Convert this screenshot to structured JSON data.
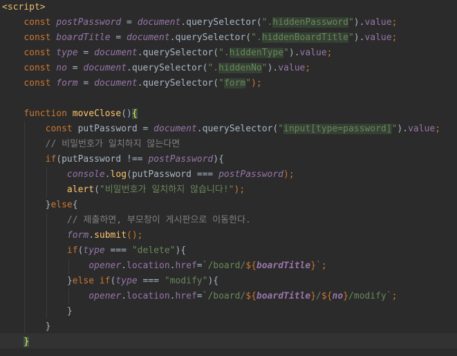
{
  "editor": {
    "language": "javascript",
    "colors": {
      "background": "#2b2b2b",
      "keyword": "#cc7832",
      "text": "#a9b7c6",
      "variable": "#9876aa",
      "function": "#ffc66d",
      "string": "#6a8759",
      "comment": "#808080",
      "tag": "#e8bf6a"
    }
  },
  "lines": [
    [
      {
        "t": "<script>",
        "c": "tag"
      }
    ],
    [
      {
        "t": "    "
      },
      {
        "t": "const ",
        "c": "kw"
      },
      {
        "t": "postPassword",
        "c": "var"
      },
      {
        "t": " = ",
        "c": "txt"
      },
      {
        "t": "document",
        "c": "obj"
      },
      {
        "t": ".querySelector(",
        "c": "txt"
      },
      {
        "t": "\".",
        "c": "str"
      },
      {
        "t": "hiddenPassword",
        "c": "str-hl"
      },
      {
        "t": "\"",
        "c": "str"
      },
      {
        "t": ").",
        "c": "txt"
      },
      {
        "t": "value",
        "c": "prop"
      },
      {
        "t": ";",
        "c": "kw"
      }
    ],
    [
      {
        "t": "    "
      },
      {
        "t": "const ",
        "c": "kw"
      },
      {
        "t": "boardTitle",
        "c": "var"
      },
      {
        "t": " = ",
        "c": "txt"
      },
      {
        "t": "document",
        "c": "obj"
      },
      {
        "t": ".querySelector(",
        "c": "txt"
      },
      {
        "t": "\".",
        "c": "str"
      },
      {
        "t": "hiddenBoardTitle",
        "c": "str-hl"
      },
      {
        "t": "\"",
        "c": "str"
      },
      {
        "t": ").",
        "c": "txt"
      },
      {
        "t": "value",
        "c": "prop"
      },
      {
        "t": ";",
        "c": "kw"
      }
    ],
    [
      {
        "t": "    "
      },
      {
        "t": "const ",
        "c": "kw"
      },
      {
        "t": "type",
        "c": "var"
      },
      {
        "t": " = ",
        "c": "txt"
      },
      {
        "t": "document",
        "c": "obj"
      },
      {
        "t": ".querySelector(",
        "c": "txt"
      },
      {
        "t": "\".",
        "c": "str"
      },
      {
        "t": "hiddenType",
        "c": "str-hl"
      },
      {
        "t": "\"",
        "c": "str"
      },
      {
        "t": ").",
        "c": "txt"
      },
      {
        "t": "value",
        "c": "prop"
      },
      {
        "t": ";",
        "c": "kw"
      }
    ],
    [
      {
        "t": "    "
      },
      {
        "t": "const ",
        "c": "kw"
      },
      {
        "t": "no",
        "c": "var"
      },
      {
        "t": " = ",
        "c": "txt"
      },
      {
        "t": "document",
        "c": "obj"
      },
      {
        "t": ".querySelector(",
        "c": "txt"
      },
      {
        "t": "\".",
        "c": "str"
      },
      {
        "t": "hiddenNo",
        "c": "str-hl"
      },
      {
        "t": "\"",
        "c": "str"
      },
      {
        "t": ").",
        "c": "txt"
      },
      {
        "t": "value",
        "c": "prop"
      },
      {
        "t": ";",
        "c": "kw"
      }
    ],
    [
      {
        "t": "    "
      },
      {
        "t": "const ",
        "c": "kw"
      },
      {
        "t": "form",
        "c": "var"
      },
      {
        "t": " = ",
        "c": "txt"
      },
      {
        "t": "document",
        "c": "obj"
      },
      {
        "t": ".querySelector(",
        "c": "txt"
      },
      {
        "t": "\"",
        "c": "str"
      },
      {
        "t": "form",
        "c": "str-hl"
      },
      {
        "t": "\"",
        "c": "str"
      },
      {
        "t": ");",
        "c": "kw"
      }
    ],
    [],
    [
      {
        "t": "    "
      },
      {
        "t": "function ",
        "c": "kw"
      },
      {
        "t": "moveClose",
        "c": "fn"
      },
      {
        "t": "()",
        "c": "txt"
      },
      {
        "t": "{",
        "c": "brace-hl"
      }
    ],
    [
      {
        "t": "        "
      },
      {
        "t": "const ",
        "c": "kw"
      },
      {
        "t": "putPassword = ",
        "c": "txt"
      },
      {
        "t": "document",
        "c": "obj"
      },
      {
        "t": ".querySelector(",
        "c": "txt"
      },
      {
        "t": "\"",
        "c": "str"
      },
      {
        "t": "input[type=password]",
        "c": "str-hl"
      },
      {
        "t": "\"",
        "c": "str"
      },
      {
        "t": ").",
        "c": "txt"
      },
      {
        "t": "value",
        "c": "prop"
      },
      {
        "t": ";",
        "c": "kw"
      }
    ],
    [
      {
        "t": "        "
      },
      {
        "t": "// 비밀번호가 일치하지 않는다면",
        "c": "cmt"
      }
    ],
    [
      {
        "t": "        "
      },
      {
        "t": "if",
        "c": "kw"
      },
      {
        "t": "(putPassword !== ",
        "c": "txt"
      },
      {
        "t": "postPassword",
        "c": "var"
      },
      {
        "t": "){",
        "c": "txt"
      }
    ],
    [
      {
        "t": "            "
      },
      {
        "t": "console",
        "c": "obj"
      },
      {
        "t": ".",
        "c": "txt"
      },
      {
        "t": "log",
        "c": "fn"
      },
      {
        "t": "(putPassword === ",
        "c": "txt"
      },
      {
        "t": "postPassword",
        "c": "var"
      },
      {
        "t": ");",
        "c": "kw"
      }
    ],
    [
      {
        "t": "            "
      },
      {
        "t": "alert",
        "c": "fn"
      },
      {
        "t": "(",
        "c": "txt"
      },
      {
        "t": "\"비밀번호가 일치하지 않습니다!\"",
        "c": "str"
      },
      {
        "t": ");",
        "c": "kw"
      }
    ],
    [
      {
        "t": "        "
      },
      {
        "t": "}",
        "c": "txt"
      },
      {
        "t": "else",
        "c": "kw"
      },
      {
        "t": "{",
        "c": "txt"
      }
    ],
    [
      {
        "t": "            "
      },
      {
        "t": "// 제출하면, 부모창이 게시판으로 이동한다.",
        "c": "cmt"
      }
    ],
    [
      {
        "t": "            "
      },
      {
        "t": "form",
        "c": "var"
      },
      {
        "t": ".",
        "c": "txt"
      },
      {
        "t": "submit",
        "c": "fn"
      },
      {
        "t": "();",
        "c": "kw"
      }
    ],
    [
      {
        "t": "            "
      },
      {
        "t": "if",
        "c": "kw"
      },
      {
        "t": "(",
        "c": "txt"
      },
      {
        "t": "type",
        "c": "var"
      },
      {
        "t": " === ",
        "c": "txt"
      },
      {
        "t": "\"delete\"",
        "c": "str"
      },
      {
        "t": "){",
        "c": "txt"
      }
    ],
    [
      {
        "t": "                "
      },
      {
        "t": "opener",
        "c": "obj"
      },
      {
        "t": ".",
        "c": "txt"
      },
      {
        "t": "location",
        "c": "prop"
      },
      {
        "t": ".",
        "c": "txt"
      },
      {
        "t": "href",
        "c": "prop"
      },
      {
        "t": "=",
        "c": "txt"
      },
      {
        "t": "`/board/",
        "c": "str"
      },
      {
        "t": "${",
        "c": "kw"
      },
      {
        "t": "boardTitle",
        "c": "bold-it"
      },
      {
        "t": "}",
        "c": "kw"
      },
      {
        "t": "`",
        "c": "str"
      },
      {
        "t": ";",
        "c": "kw"
      }
    ],
    [
      {
        "t": "            "
      },
      {
        "t": "}",
        "c": "txt"
      },
      {
        "t": "else if",
        "c": "kw"
      },
      {
        "t": "(",
        "c": "txt"
      },
      {
        "t": "type",
        "c": "var"
      },
      {
        "t": " === ",
        "c": "txt"
      },
      {
        "t": "\"modify\"",
        "c": "str"
      },
      {
        "t": "){",
        "c": "txt"
      }
    ],
    [
      {
        "t": "                "
      },
      {
        "t": "opener",
        "c": "obj"
      },
      {
        "t": ".",
        "c": "txt"
      },
      {
        "t": "location",
        "c": "prop"
      },
      {
        "t": ".",
        "c": "txt"
      },
      {
        "t": "href",
        "c": "prop"
      },
      {
        "t": "=",
        "c": "txt"
      },
      {
        "t": "`/board/",
        "c": "str"
      },
      {
        "t": "${",
        "c": "kw"
      },
      {
        "t": "boardTitle",
        "c": "bold-it"
      },
      {
        "t": "}",
        "c": "kw"
      },
      {
        "t": "/",
        "c": "str"
      },
      {
        "t": "${",
        "c": "kw"
      },
      {
        "t": "no",
        "c": "bold-it"
      },
      {
        "t": "}",
        "c": "kw"
      },
      {
        "t": "/modify`",
        "c": "str"
      },
      {
        "t": ";",
        "c": "kw"
      }
    ],
    [
      {
        "t": "            "
      },
      {
        "t": "}",
        "c": "txt"
      }
    ],
    [
      {
        "t": "        "
      },
      {
        "t": "}",
        "c": "txt"
      }
    ],
    [
      {
        "t": "    "
      },
      {
        "t": "}",
        "c": "brace-hl"
      }
    ]
  ]
}
